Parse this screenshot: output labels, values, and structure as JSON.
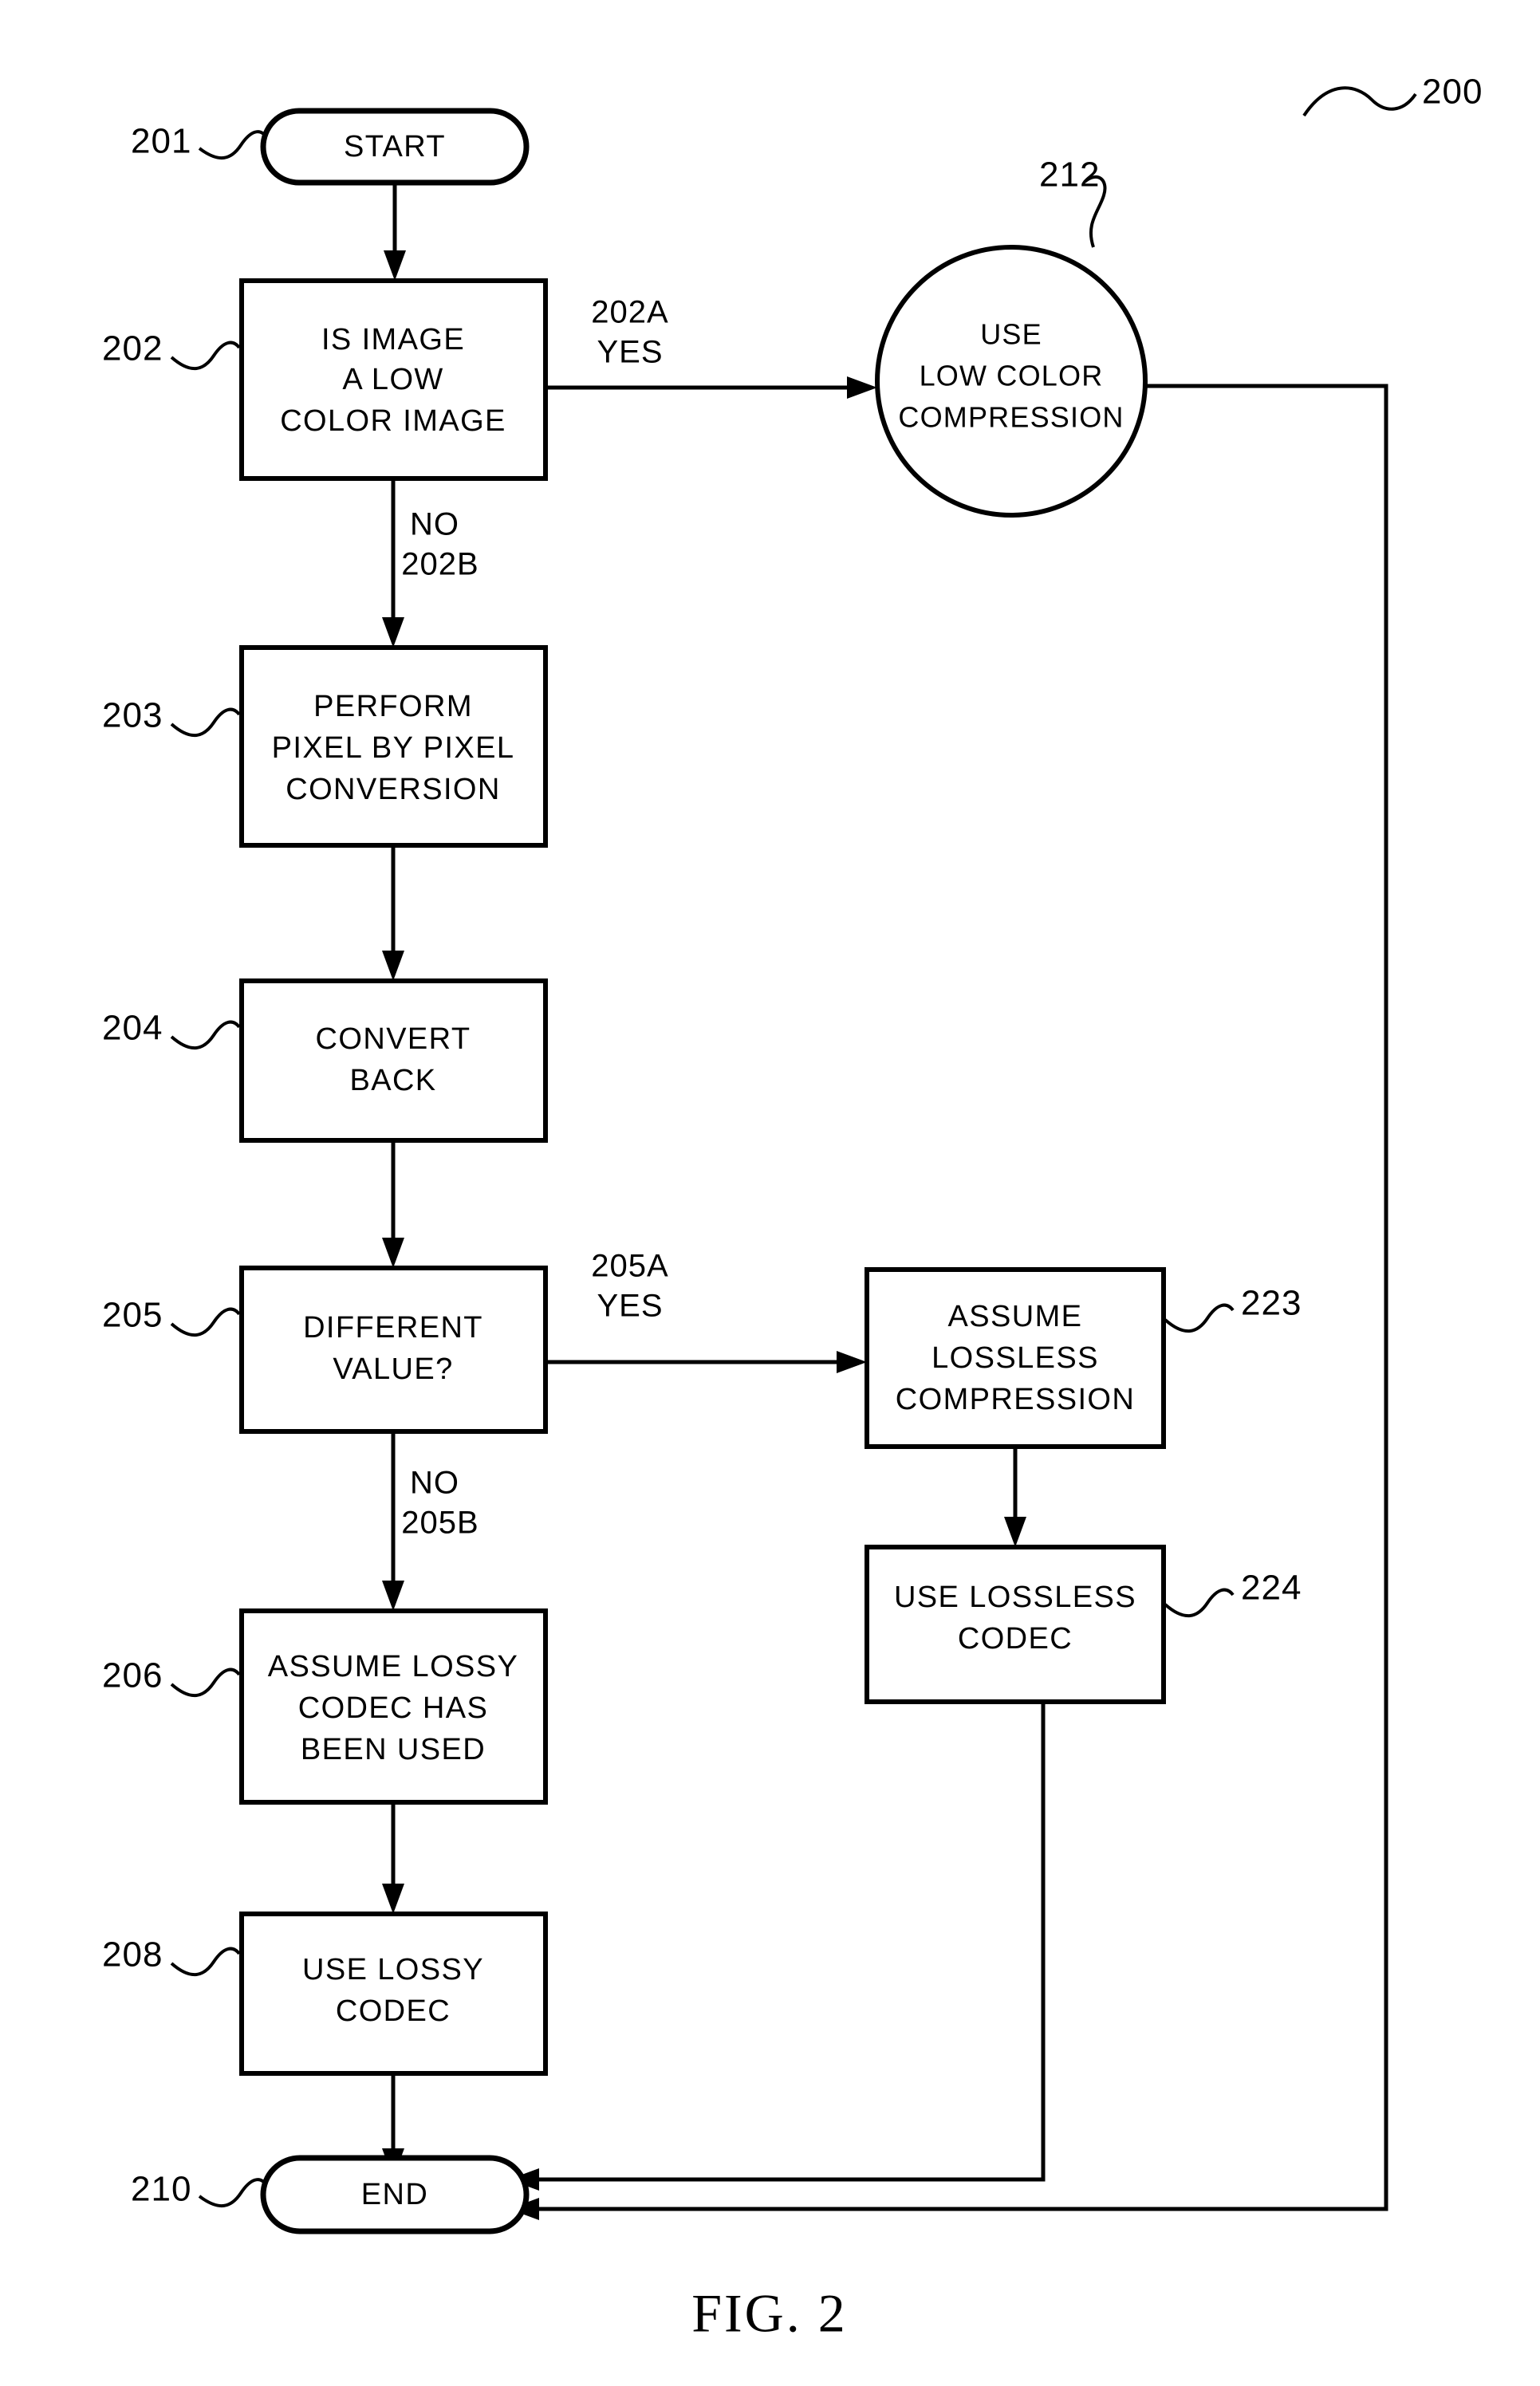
{
  "figure": {
    "caption": "FIG. 2",
    "ref_number": "200"
  },
  "nodes": {
    "start": {
      "ref": "201",
      "label": "START",
      "shape": "terminator"
    },
    "decision_low_color": {
      "ref": "202",
      "shape": "process",
      "line1": "IS IMAGE",
      "line2": "A LOW",
      "line3": "COLOR IMAGE"
    },
    "low_color_compression": {
      "ref": "212",
      "shape": "circle",
      "line1": "USE",
      "line2": "LOW COLOR",
      "line3": "COMPRESSION"
    },
    "pixel_conversion": {
      "ref": "203",
      "shape": "process",
      "line1": "PERFORM",
      "line2": "PIXEL BY PIXEL",
      "line3": "CONVERSION"
    },
    "convert_back": {
      "ref": "204",
      "shape": "process",
      "line1": "CONVERT",
      "line2": "BACK"
    },
    "decision_different_value": {
      "ref": "205",
      "shape": "process",
      "line1": "DIFFERENT",
      "line2": "VALUE?"
    },
    "assume_lossless": {
      "ref": "223",
      "shape": "process",
      "line1": "ASSUME",
      "line2": "LOSSLESS",
      "line3": "COMPRESSION"
    },
    "use_lossless_codec": {
      "ref": "224",
      "shape": "process",
      "line1": "USE LOSSLESS",
      "line2": "CODEC"
    },
    "assume_lossy": {
      "ref": "206",
      "shape": "process",
      "line1": "ASSUME LOSSY",
      "line2": "CODEC HAS",
      "line3": "BEEN USED"
    },
    "use_lossy_codec": {
      "ref": "208",
      "shape": "process",
      "line1": "USE LOSSY",
      "line2": "CODEC"
    },
    "end": {
      "ref": "210",
      "label": "END",
      "shape": "terminator"
    }
  },
  "edge_labels": {
    "yes_202a_top": "202A",
    "yes_202a_bottom": "YES",
    "no_202b_top": "NO",
    "no_202b_bottom": "202B",
    "yes_205a_top": "205A",
    "yes_205a_bottom": "YES",
    "no_205b_top": "NO",
    "no_205b_bottom": "205B"
  }
}
